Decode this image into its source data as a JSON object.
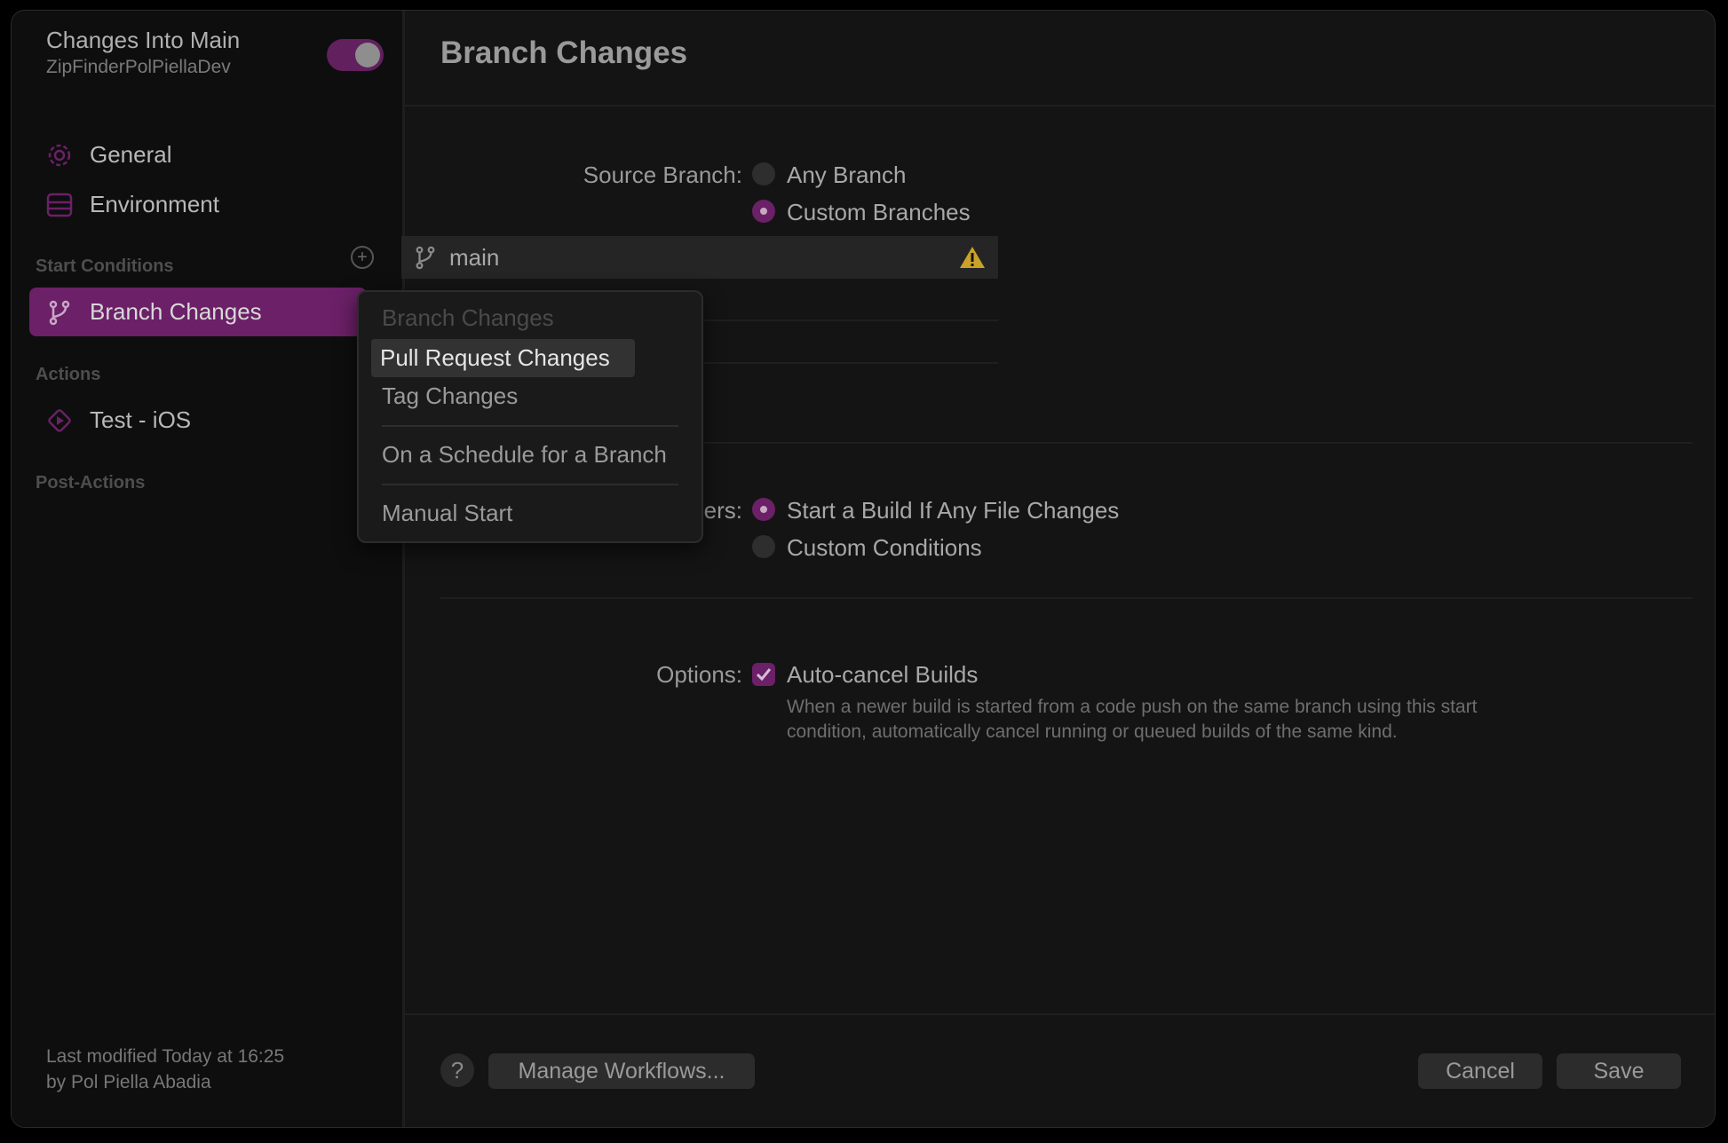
{
  "sidebar": {
    "workflow_title": "Changes Into Main",
    "workflow_subtitle": "ZipFinderPolPiellaDev",
    "toggle_on": true,
    "items_top": [
      {
        "label": "General",
        "icon": "gear-icon"
      },
      {
        "label": "Environment",
        "icon": "environment-icon"
      }
    ],
    "start_conditions_header": "Start Conditions",
    "start_conditions": [
      {
        "label": "Branch Changes",
        "icon": "branch-icon",
        "selected": true
      }
    ],
    "actions_header": "Actions",
    "actions": [
      {
        "label": "Test - iOS",
        "icon": "play-icon"
      }
    ],
    "post_actions_header": "Post-Actions",
    "last_modified_line1": "Last modified Today at 16:25",
    "last_modified_line2": "by Pol Piella Abadia"
  },
  "main": {
    "title": "Branch Changes",
    "source_branch_label": "Source Branch:",
    "source_options": [
      {
        "label": "Any Branch",
        "selected": false
      },
      {
        "label": "Custom Branches",
        "selected": true
      }
    ],
    "branches": [
      {
        "name": "main",
        "warning": true
      }
    ],
    "add_symbol": "+",
    "remove_symbol": "—",
    "files_label_partial": "ers:",
    "files_options": [
      {
        "label": "Start a Build If Any File Changes",
        "selected": true
      },
      {
        "label": "Custom Conditions",
        "selected": false
      }
    ],
    "options_label": "Options:",
    "auto_cancel_label": "Auto-cancel Builds",
    "auto_cancel_checked": true,
    "auto_cancel_help_line1": "When a newer build is started from a code push on the same branch using this start",
    "auto_cancel_help_line2": "condition, automatically cancel running or queued builds of the same kind."
  },
  "footer": {
    "help_symbol": "?",
    "manage_label": "Manage Workflows...",
    "cancel_label": "Cancel",
    "save_label": "Save"
  },
  "menu": {
    "items": [
      {
        "label": "Branch Changes",
        "state": "disabled"
      },
      {
        "label": "Pull Request Changes",
        "state": "highlighted"
      },
      {
        "label": "Tag Changes",
        "state": "normal"
      },
      {
        "label": "On a Schedule for a Branch",
        "state": "normal"
      },
      {
        "label": "Manual Start",
        "state": "normal"
      }
    ]
  },
  "colors": {
    "accent": "#6b2067",
    "warning": "#c9a227"
  }
}
